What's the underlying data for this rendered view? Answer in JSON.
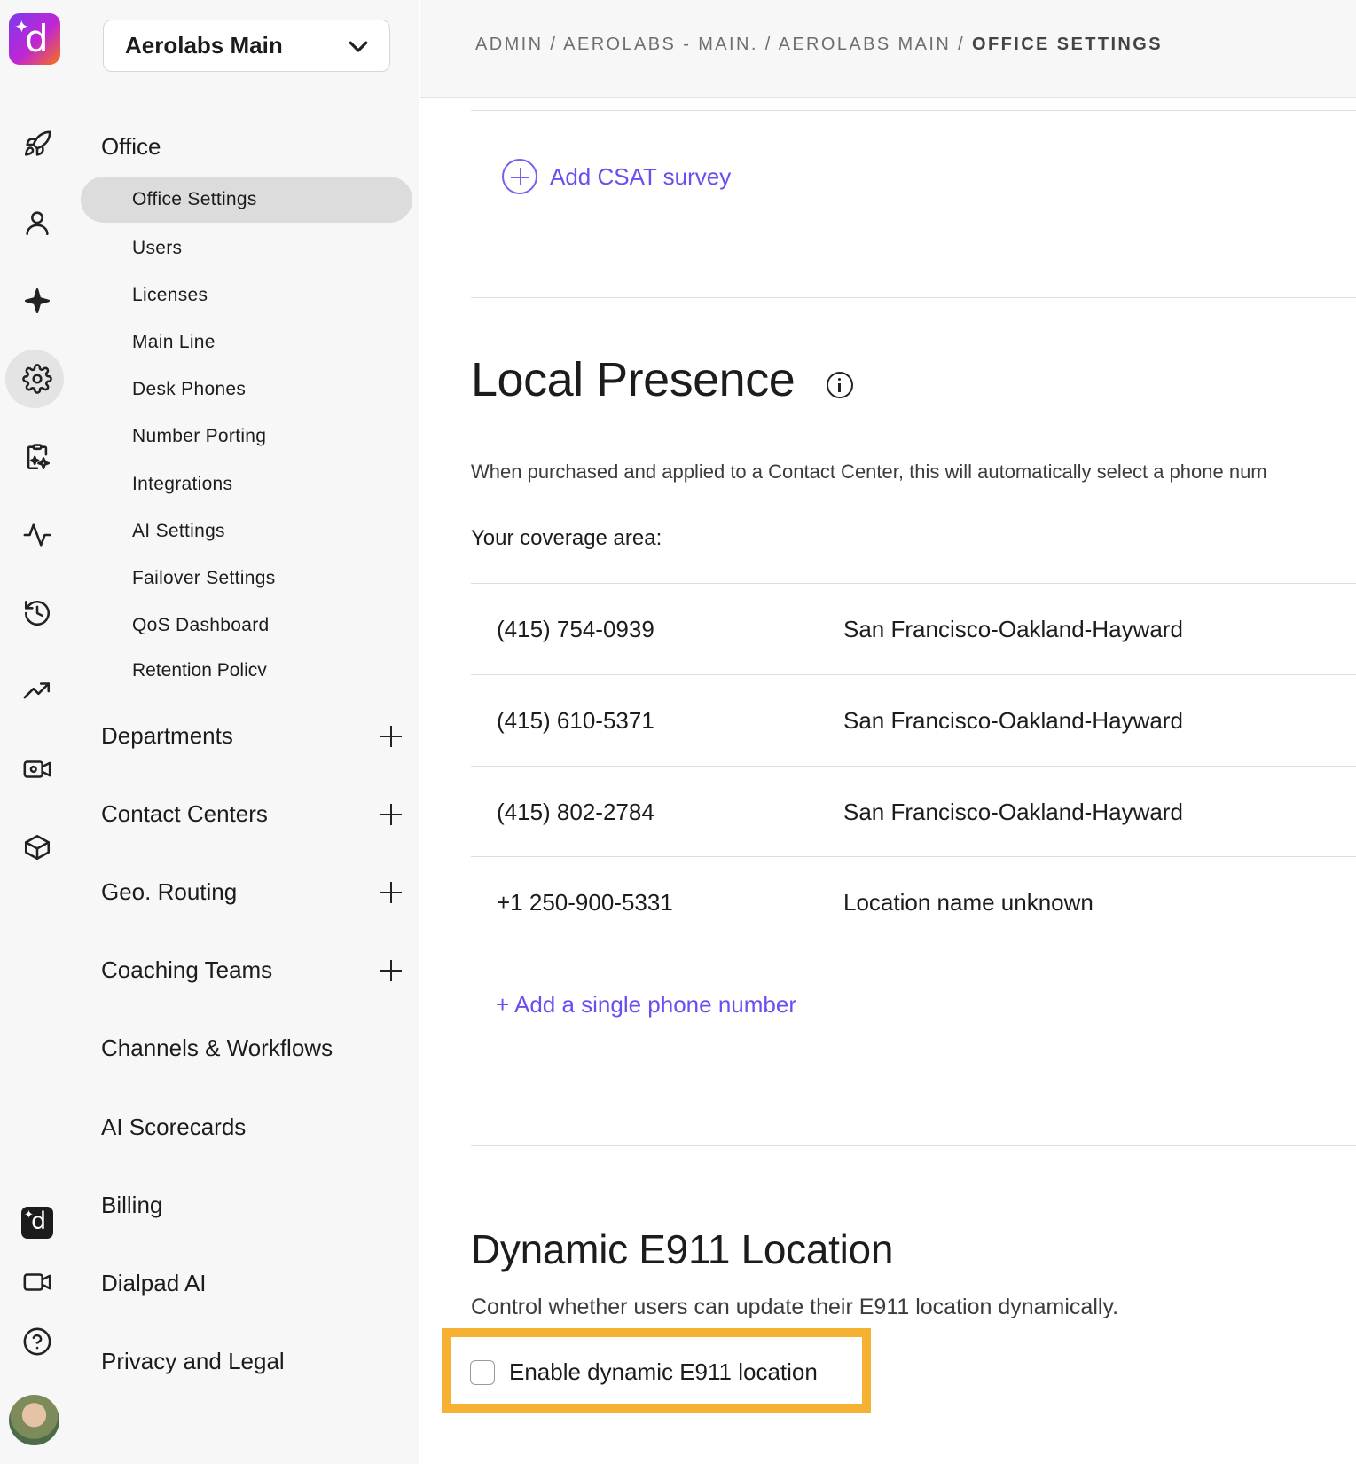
{
  "rail": {
    "logo_letter": "d",
    "items": [
      "rocket",
      "user",
      "sparkle",
      "settings",
      "clipboard-sparkle",
      "activity",
      "history",
      "trending",
      "video-settings",
      "box"
    ],
    "bottom": [
      "dialpad-logo",
      "video",
      "help"
    ],
    "mini_logo_letter": "d"
  },
  "sidebar": {
    "org_name": "Aerolabs Main",
    "office_heading": "Office",
    "office_items": [
      "Office Settings",
      "Users",
      "Licenses",
      "Main Line",
      "Desk Phones",
      "Number Porting",
      "Integrations",
      "AI Settings",
      "Failover Settings",
      "QoS Dashboard",
      "Retention Policy"
    ],
    "sections": [
      {
        "label": "Departments",
        "expandable": true
      },
      {
        "label": "Contact Centers",
        "expandable": true
      },
      {
        "label": "Geo. Routing",
        "expandable": true
      },
      {
        "label": "Coaching Teams",
        "expandable": true
      },
      {
        "label": "Channels & Workflows",
        "expandable": false
      },
      {
        "label": "AI Scorecards",
        "expandable": false
      },
      {
        "label": "Billing",
        "expandable": false
      },
      {
        "label": "Dialpad AI",
        "expandable": false
      },
      {
        "label": "Privacy and Legal",
        "expandable": false
      }
    ]
  },
  "header": {
    "crumb1": "ADMIN",
    "crumb2": "AEROLABS - MAIN.",
    "crumb3": "AEROLABS MAIN",
    "current": "OFFICE SETTINGS",
    "sep": " / "
  },
  "main": {
    "add_csat": "Add CSAT survey",
    "local_presence": {
      "title": "Local Presence",
      "description": "When purchased and applied to a Contact Center, this will automatically select a phone num",
      "coverage_label": "Your coverage area:",
      "numbers": [
        {
          "number": "(415) 754-0939",
          "location": "San Francisco-Oakland-Hayward"
        },
        {
          "number": "(415) 610-5371",
          "location": "San Francisco-Oakland-Hayward"
        },
        {
          "number": "(415) 802-2784",
          "location": "San Francisco-Oakland-Hayward"
        },
        {
          "number": "+1 250-900-5331",
          "location": "Location name unknown"
        }
      ],
      "add_number": "+ Add a single phone number"
    },
    "e911": {
      "title": "Dynamic E911 Location",
      "description": "Control whether users can update their E911 location dynamically.",
      "checkbox_label": "Enable dynamic E911 location",
      "checked": false
    }
  },
  "colors": {
    "accent": "#6d4cf0",
    "highlight": "#f6b133"
  }
}
